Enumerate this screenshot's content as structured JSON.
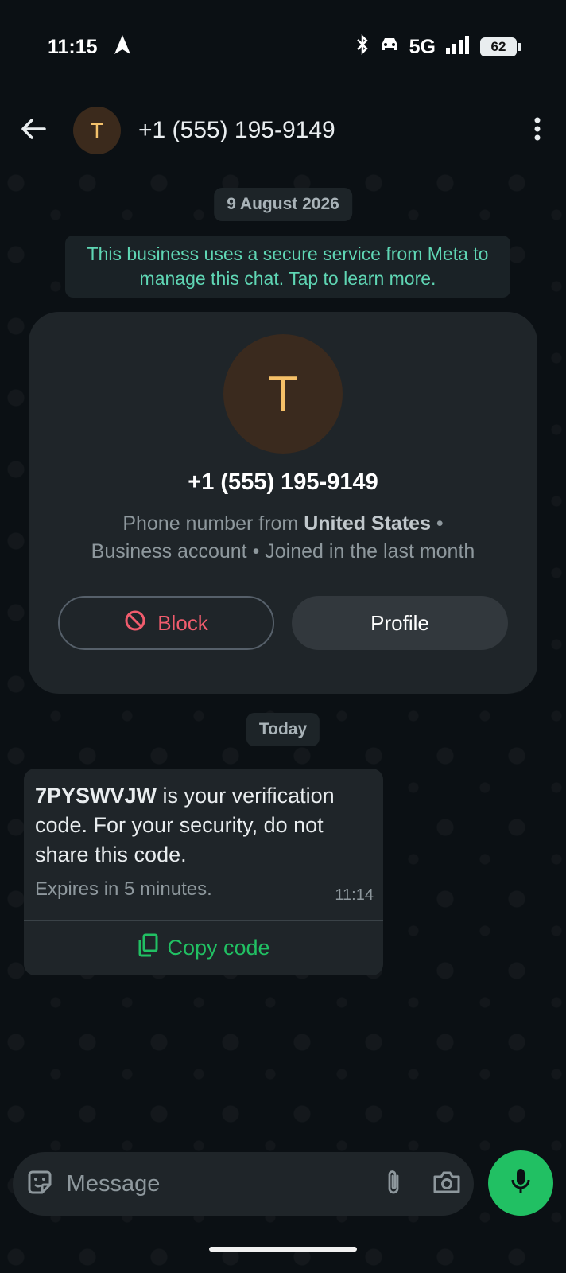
{
  "status_bar": {
    "time": "11:15",
    "network": "5G",
    "battery": "62",
    "icons": [
      "navigation-arrow-icon",
      "bluetooth-icon",
      "car-icon",
      "signal-icon",
      "battery-icon"
    ]
  },
  "header": {
    "avatar_initial": "T",
    "title": "+1 (555) 195-9149",
    "icons": [
      "back-arrow-icon",
      "more-vertical-icon"
    ]
  },
  "chat": {
    "date_1": "9 August 2026",
    "meta_notice": "This business uses a secure service from Meta to manage this chat. Tap to learn more.",
    "contact_card": {
      "avatar_initial": "T",
      "phone": "+1 (555) 195-9149",
      "desc_prefix": "Phone number from ",
      "desc_country": "United States",
      "desc_suffix": " • Business account • Joined in the last month",
      "block_label": "Block",
      "profile_label": "Profile"
    },
    "date_2": "Today",
    "message": {
      "code": "7PYSWVJW",
      "text": " is your verification code. For your security, do not share this code.",
      "footer": "Expires in 5 minutes.",
      "time": "11:14",
      "copy_label": "Copy code"
    }
  },
  "input": {
    "placeholder": "Message"
  },
  "colors": {
    "background": "#0b1014",
    "bubble": "#1f2529",
    "accent_green": "#21c063",
    "block_red": "#f15c6d",
    "notice_teal": "#5fd6b4",
    "avatar_orange": "#f5c068"
  }
}
